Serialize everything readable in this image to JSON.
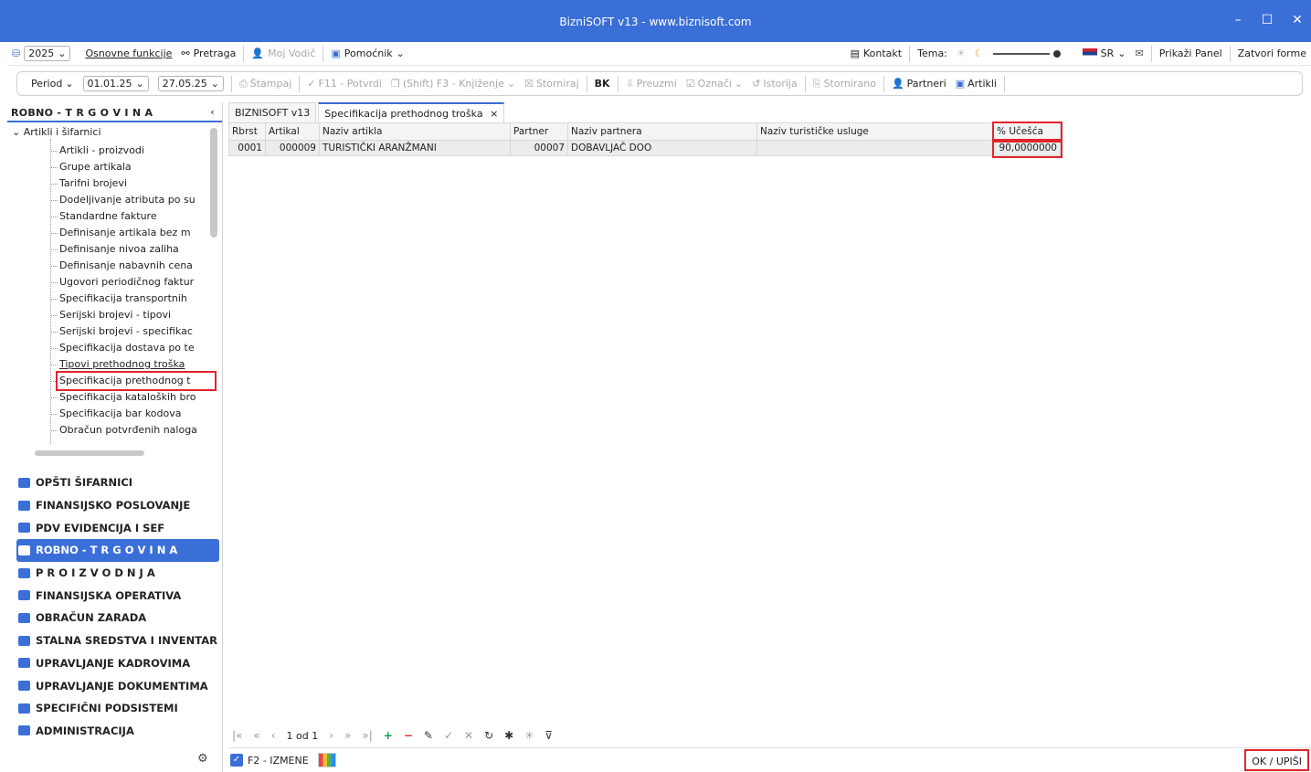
{
  "window": {
    "title": "BizniSOFT v13 - www.biznisoft.com"
  },
  "menubar": {
    "year": "2025",
    "basic_functions": "Osnovne funkcije",
    "search": "Pretraga",
    "my_guide": "Moj Vodič",
    "assistant": "Pomoćnik",
    "contact": "Kontakt",
    "theme_label": "Tema:",
    "language": "SR",
    "show_panel": "Prikaži Panel",
    "close_forms": "Zatvori forme"
  },
  "toolbar": {
    "period_label": "Period",
    "date_from": "01.01.25",
    "date_to": "27.05.25",
    "print": "Štampaj",
    "confirm": "F11 - Potvrdi",
    "posting": "(Shift) F3 - Knjiženje",
    "cancel": "Storniraj",
    "bk": "BK",
    "take": "Preuzmi",
    "mark": "Označi",
    "history": "Istorija",
    "cancelled": "Stornirano",
    "partners": "Partneri",
    "articles": "Artikli"
  },
  "left_panel": {
    "header": "ROBNO - T R G O V I N A",
    "tree_parent": "Artikli i šifarnici",
    "tree_items": [
      "Artikli - proizvodi",
      "Grupe artikala",
      "Tarifni brojevi",
      "Dodeljivanje atributa po su",
      "Standardne fakture",
      "Definisanje artikala bez m",
      "Definisanje nivoa zaliha",
      "Definisanje nabavnih cena",
      "Ugovori periodičnog faktur",
      "Specifikacija transportnih",
      "Serijski brojevi - tipovi",
      "Serijski brojevi - specifikac",
      "Specifikacija dostava po te",
      "Tipovi prethodnog troška",
      "Specifikacija prethodnog t",
      "Specifikacija kataloških bro",
      "Specifikacija bar kodova",
      "Obračun potvrđenih naloga"
    ],
    "nav_items": [
      "OPŠTI ŠIFARNICI",
      "FINANSIJSKO POSLOVANJE",
      "PDV EVIDENCIJA I SEF",
      "ROBNO - T R G O V I N A",
      "P R O I Z V O D N J A",
      "FINANSIJSKA OPERATIVA",
      "OBRAČUN ZARADA",
      "STALNA SREDSTVA I INVENTAR",
      "UPRAVLJANJE KADROVIMA",
      "UPRAVLJANJE DOKUMENTIMA",
      "SPECIFIČNI PODSISTEMI",
      "ADMINISTRACIJA"
    ]
  },
  "tabs": [
    "BIZNISOFT v13",
    "Specifikacija prethodnog troška"
  ],
  "grid": {
    "columns": [
      "Rbrst",
      "Artikal",
      "Naziv artikla",
      "Partner",
      "Naziv partnera",
      "Naziv turističke usluge",
      "% Učešća"
    ],
    "rows": [
      [
        "0001",
        "000009",
        "TURISTIČKI ARANŽMANI",
        "00007",
        "DOBAVLJAČ DOO",
        "",
        "90,0000000"
      ]
    ]
  },
  "pager": {
    "page_text": "1 od 1"
  },
  "bottom": {
    "edit_mode": "F2 - IZMENE",
    "ok_button": "OK / UPIŠI"
  }
}
